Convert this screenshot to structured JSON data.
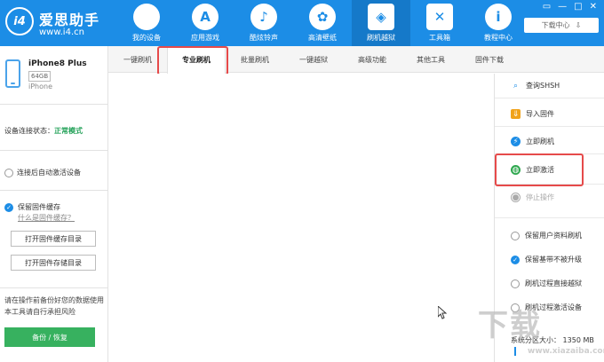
{
  "app": {
    "name": "爱思助手",
    "url": "www.i4.cn",
    "logo_mark": "i4"
  },
  "nav": {
    "items": [
      {
        "label": "我的设备",
        "icon": "apple-icon",
        "glyph": ""
      },
      {
        "label": "应用游戏",
        "icon": "app-store-icon",
        "glyph": "A"
      },
      {
        "label": "酷炫铃声",
        "icon": "bell-icon",
        "glyph": "♪"
      },
      {
        "label": "高清壁纸",
        "icon": "flower-icon",
        "glyph": "✿"
      },
      {
        "label": "刷机越狱",
        "icon": "dropbox-icon",
        "glyph": "◈"
      },
      {
        "label": "工具箱",
        "icon": "tools-icon",
        "glyph": "✕"
      },
      {
        "label": "教程中心",
        "icon": "info-icon",
        "glyph": "i"
      }
    ],
    "active_index": 4
  },
  "window": {
    "controls": [
      "▭",
      "—",
      "□",
      "✕"
    ]
  },
  "download_center": {
    "label": "下载中心",
    "icon": "download-icon",
    "glyph": "⇩"
  },
  "device": {
    "name": "iPhone8 Plus",
    "capacity": "64GB",
    "type": "iPhone"
  },
  "sidebar": {
    "connection_label": "设备连接状态：",
    "connection_value": "正常模式",
    "auto_activate_label": "连接后自动激活设备",
    "keep_cache_label": "保留固件缓存",
    "what_is_cache": "什么是固件缓存？",
    "open_cache_dir": "打开固件缓存目录",
    "open_store_dir": "打开固件存储目录",
    "warning": "请在操作前备份好您的数据使用本工具请自行承担风险",
    "backup_button": "备份 / 恢复"
  },
  "tabs": [
    {
      "label": "一键刷机"
    },
    {
      "label": "专业刷机"
    },
    {
      "label": "批量刷机"
    },
    {
      "label": "一键越狱"
    },
    {
      "label": "高级功能"
    },
    {
      "label": "其他工具"
    },
    {
      "label": "固件下载"
    }
  ],
  "active_tab": 1,
  "right_panel": {
    "actions": [
      {
        "label": "查询SHSH",
        "icon": "search-icon",
        "glyph": "⌕"
      },
      {
        "label": "导入固件",
        "icon": "import-icon",
        "glyph": "⇓"
      },
      {
        "label": "立即刷机",
        "icon": "flash-icon",
        "glyph": "⚡"
      },
      {
        "label": "立即激活",
        "icon": "globe-icon",
        "glyph": "◍"
      },
      {
        "label": "停止操作",
        "icon": "stop-icon",
        "glyph": "●"
      }
    ],
    "options": [
      {
        "label": "保留用户资料刷机",
        "checked": false
      },
      {
        "label": "保留基带不被升级",
        "checked": true
      },
      {
        "label": "刷机过程直接越狱",
        "checked": false
      },
      {
        "label": "刷机过程激活设备",
        "checked": false
      }
    ],
    "partition_label": "系统分区大小：",
    "partition_value": "1350 MB"
  },
  "watermark": {
    "big": "下载",
    "small": "www.xiazaiba.com"
  },
  "colors": {
    "brand_blue": "#1c8de6",
    "highlight_red": "#e64a4a",
    "status_green": "#25a25a",
    "backup_green": "#37b15f"
  }
}
